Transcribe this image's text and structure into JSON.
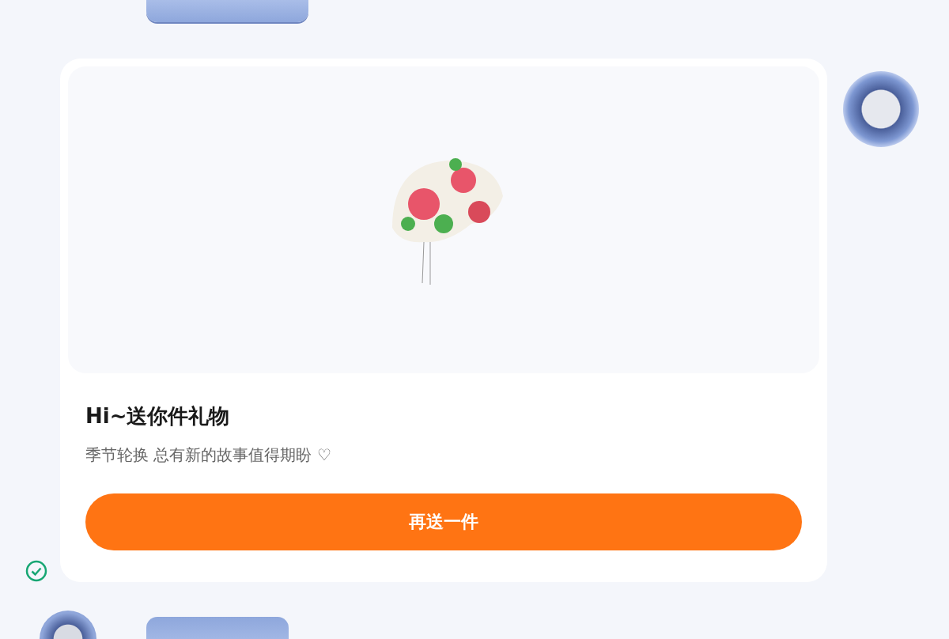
{
  "message": {
    "title": "Hi~送你件礼物",
    "subtitle": "季节轮换 总有新的故事值得期盼 ♡",
    "button": "再送一件",
    "delivered": true
  }
}
